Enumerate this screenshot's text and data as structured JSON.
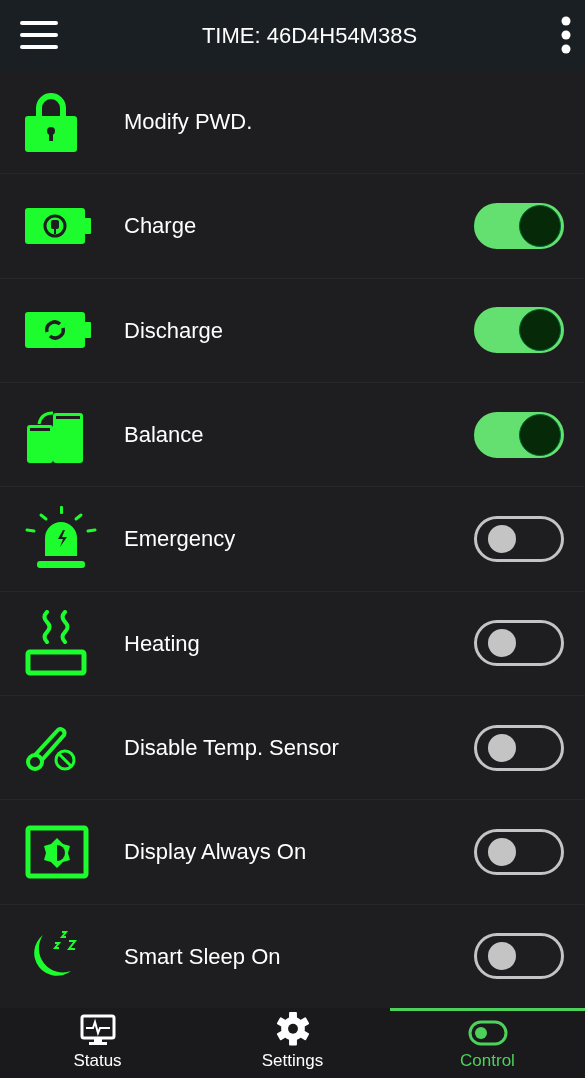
{
  "header": {
    "title": "TIME: 46D4H54M38S"
  },
  "rows": [
    {
      "kind": "action",
      "label": "Modify PWD."
    },
    {
      "kind": "toggle",
      "label": "Charge",
      "on": true
    },
    {
      "kind": "toggle",
      "label": "Discharge",
      "on": true
    },
    {
      "kind": "toggle",
      "label": "Balance",
      "on": true
    },
    {
      "kind": "toggle",
      "label": "Emergency",
      "on": false
    },
    {
      "kind": "toggle",
      "label": "Heating",
      "on": false
    },
    {
      "kind": "toggle",
      "label": "Disable Temp. Sensor",
      "on": false
    },
    {
      "kind": "toggle",
      "label": "Display Always On",
      "on": false
    },
    {
      "kind": "toggle",
      "label": "Smart Sleep On",
      "on": false
    }
  ],
  "tabs": [
    {
      "label": "Status",
      "selected": false
    },
    {
      "label": "Settings",
      "selected": false
    },
    {
      "label": "Control",
      "selected": true
    }
  ]
}
